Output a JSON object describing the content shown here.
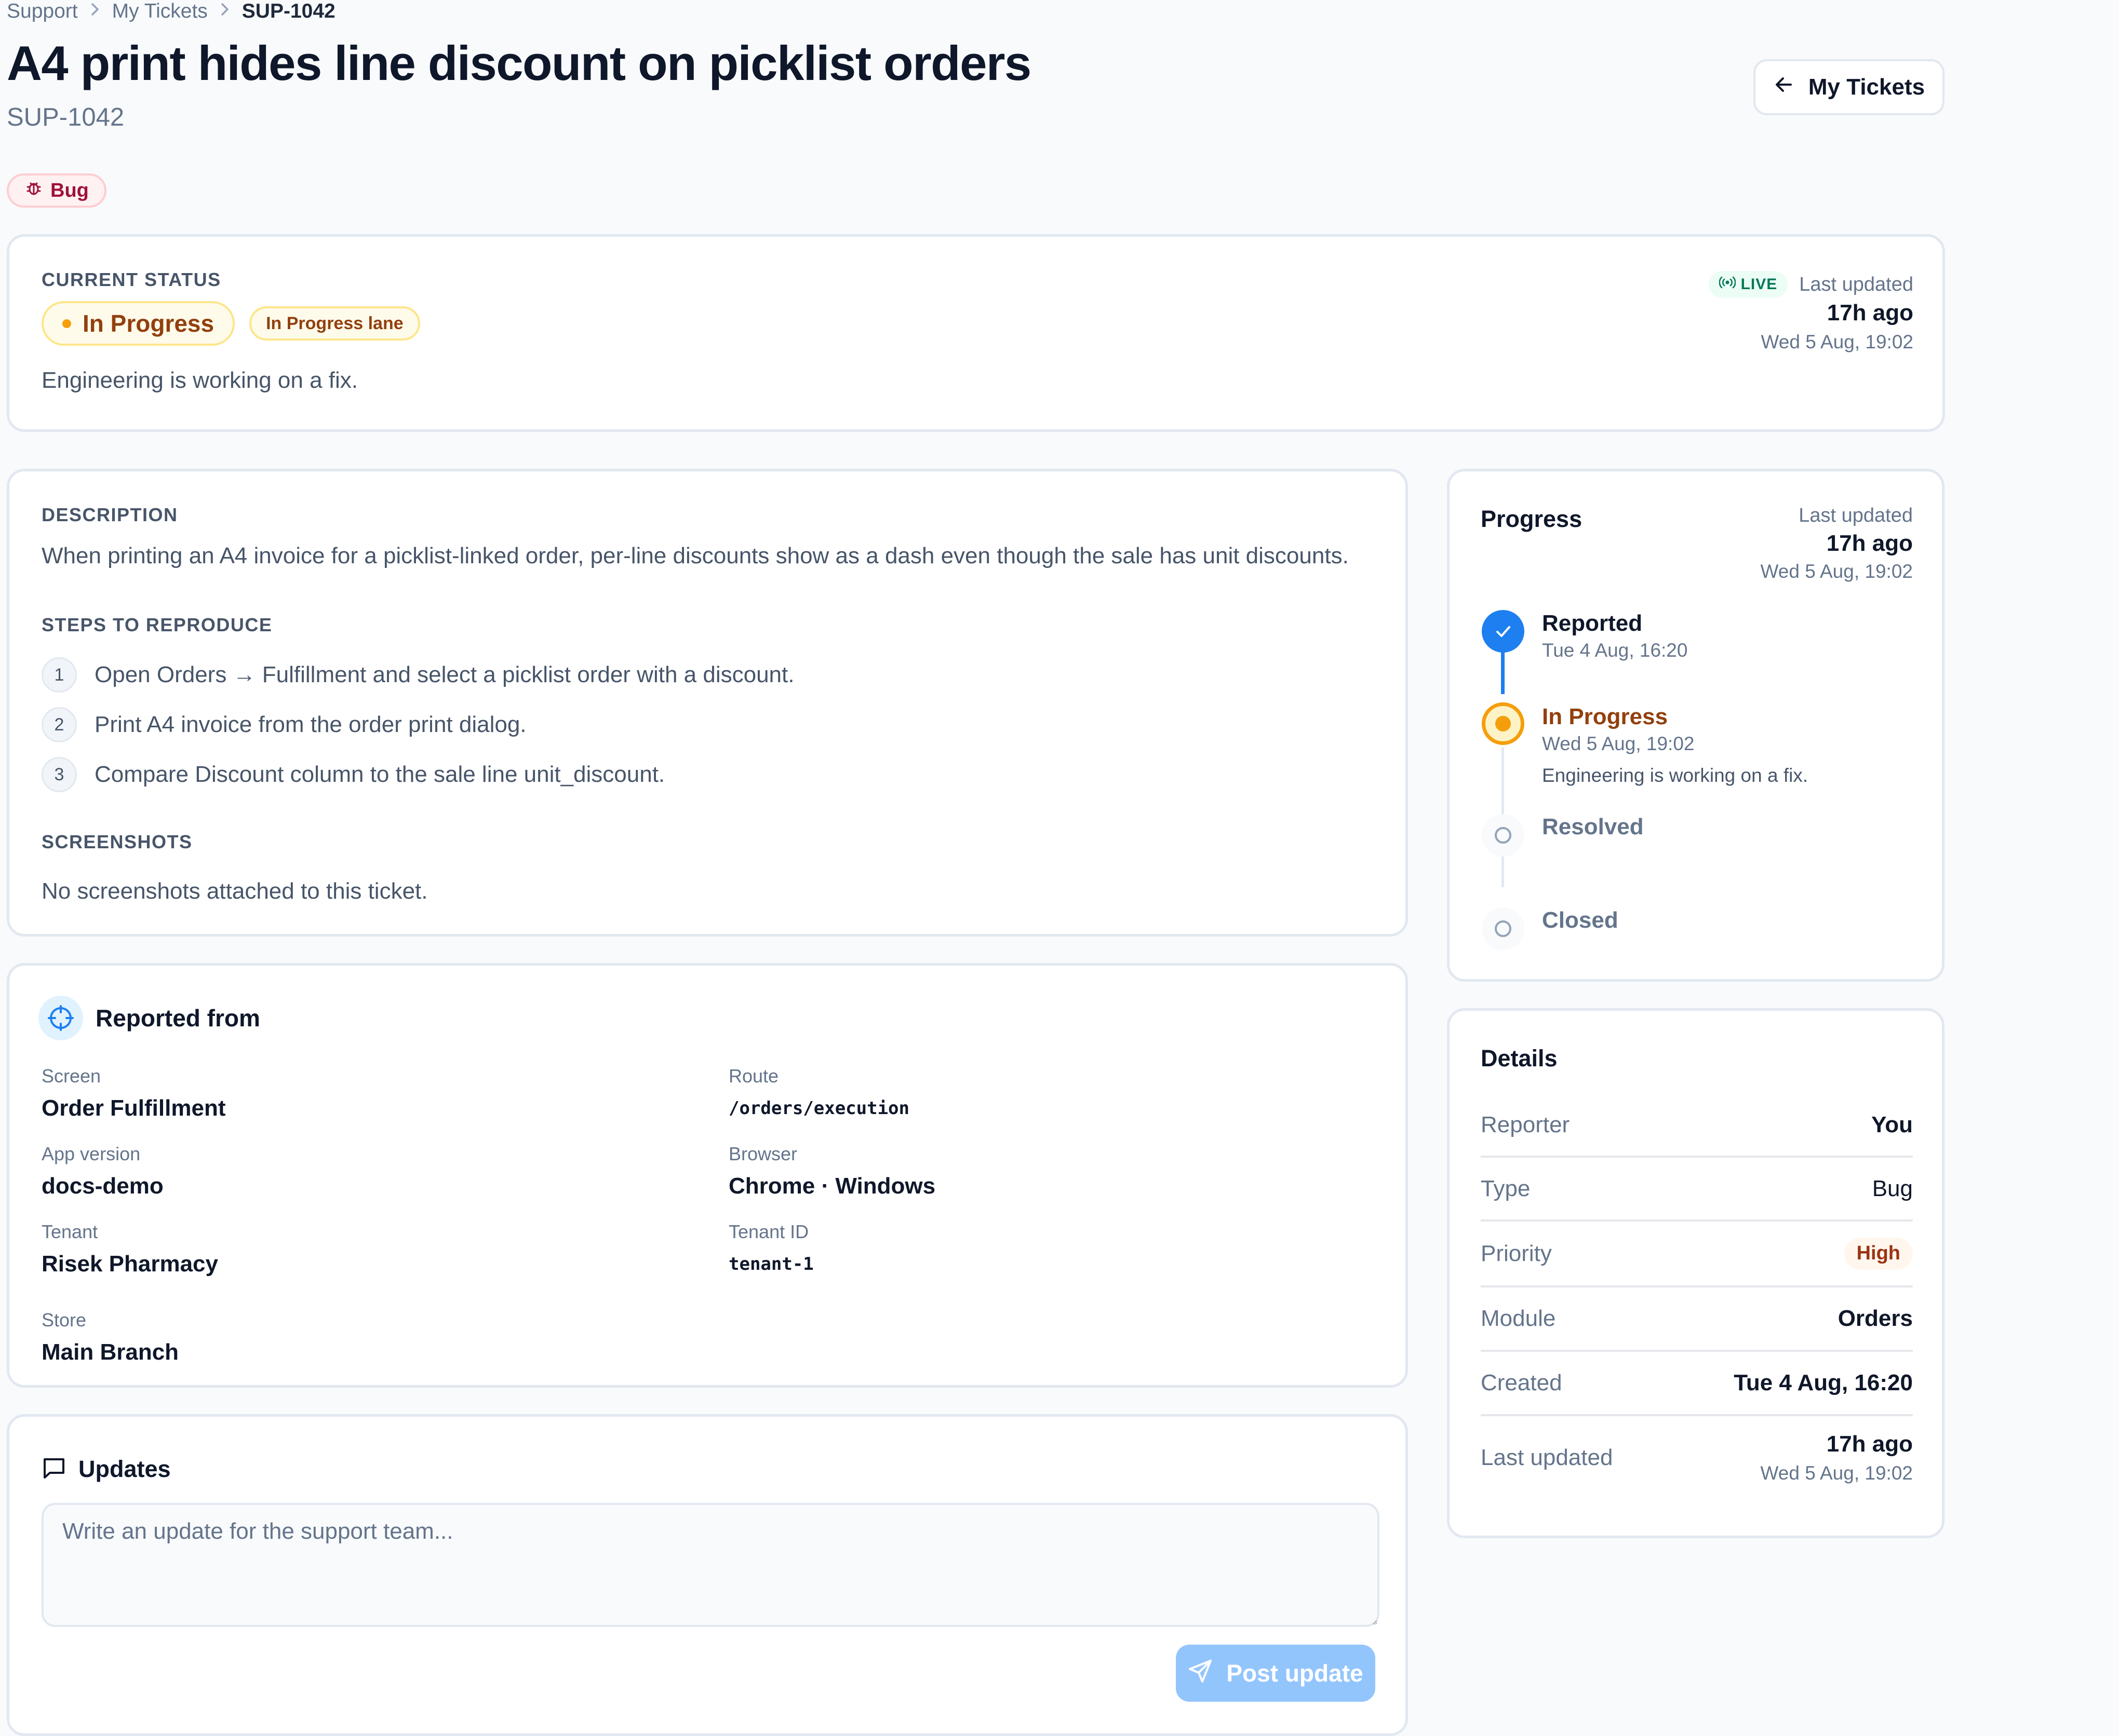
{
  "breadcrumb": {
    "items": [
      "Support",
      "My Tickets"
    ],
    "current": "SUP-1042"
  },
  "header": {
    "title": "A4 print hides line discount on picklist orders",
    "ticket_id": "SUP-1042",
    "back_label": "My Tickets",
    "type_label": "Bug"
  },
  "status": {
    "section_label": "CURRENT STATUS",
    "status": "In Progress",
    "lane": "In Progress lane",
    "note": "Engineering is working on a fix.",
    "live_label": "LIVE",
    "last_updated_label": "Last updated",
    "relative": "17h ago",
    "timestamp": "Wed 5 Aug, 19:02"
  },
  "description": {
    "label": "DESCRIPTION",
    "text": "When printing an A4 invoice for a picklist-linked order, per-line discounts show as a dash even though the sale has unit discounts.",
    "steps_label": "STEPS TO REPRODUCE",
    "steps": [
      {
        "num": "1",
        "text": "Open Orders → Fulfillment and select a picklist order with a discount."
      },
      {
        "num": "2",
        "text": "Print A4 invoice from the order print dialog."
      },
      {
        "num": "3",
        "text": "Compare Discount column to the sale line unit_discount."
      }
    ],
    "screenshots_label": "SCREENSHOTS",
    "screenshots_empty": "No screenshots attached to this ticket."
  },
  "reported_from": {
    "title": "Reported from",
    "screen_label": "Screen",
    "screen": "Order Fulfillment",
    "route_label": "Route",
    "route": "/orders/execution",
    "app_version_label": "App version",
    "app_version": "docs-demo",
    "browser_label": "Browser",
    "browser": "Chrome · Windows",
    "tenant_label": "Tenant",
    "tenant": "Risek Pharmacy",
    "tenant_id_label": "Tenant ID",
    "tenant_id": "tenant-1",
    "store_label": "Store",
    "store": "Main Branch"
  },
  "updates": {
    "title": "Updates",
    "placeholder": "Write an update for the support team...",
    "post_label": "Post update"
  },
  "progress": {
    "title": "Progress",
    "last_updated_label": "Last updated",
    "relative": "17h ago",
    "timestamp": "Wed 5 Aug, 19:02",
    "steps": [
      {
        "label": "Reported",
        "date": "Tue 4 Aug, 16:20",
        "note": ""
      },
      {
        "label": "In Progress",
        "date": "Wed 5 Aug, 19:02",
        "note": "Engineering is working on a fix."
      },
      {
        "label": "Resolved",
        "date": "",
        "note": ""
      },
      {
        "label": "Closed",
        "date": "",
        "note": ""
      }
    ]
  },
  "details": {
    "title": "Details",
    "reporter_label": "Reporter",
    "reporter": "You",
    "type_label": "Type",
    "type": "Bug",
    "priority_label": "Priority",
    "priority": "High",
    "module_label": "Module",
    "module": "Orders",
    "created_label": "Created",
    "created": "Tue 4 Aug, 16:20",
    "last_updated_label": "Last updated",
    "last_updated_relative": "17h ago",
    "last_updated_timestamp": "Wed 5 Aug, 19:02"
  },
  "colors": {
    "accent": "#1d7ff0",
    "in_progress": "#f59e0b",
    "bug": "#9f1239",
    "priority_high": "#9a3412",
    "live": "#047857",
    "post_button": "#93c5fd"
  },
  "icons": {
    "breadcrumb_separator": "chevron-right-icon",
    "back": "arrow-left-icon",
    "bug": "bug-icon",
    "live": "broadcast-icon",
    "reported_from": "crosshair-icon",
    "updates": "message-square-icon",
    "post": "send-icon",
    "step_done": "check-icon"
  }
}
